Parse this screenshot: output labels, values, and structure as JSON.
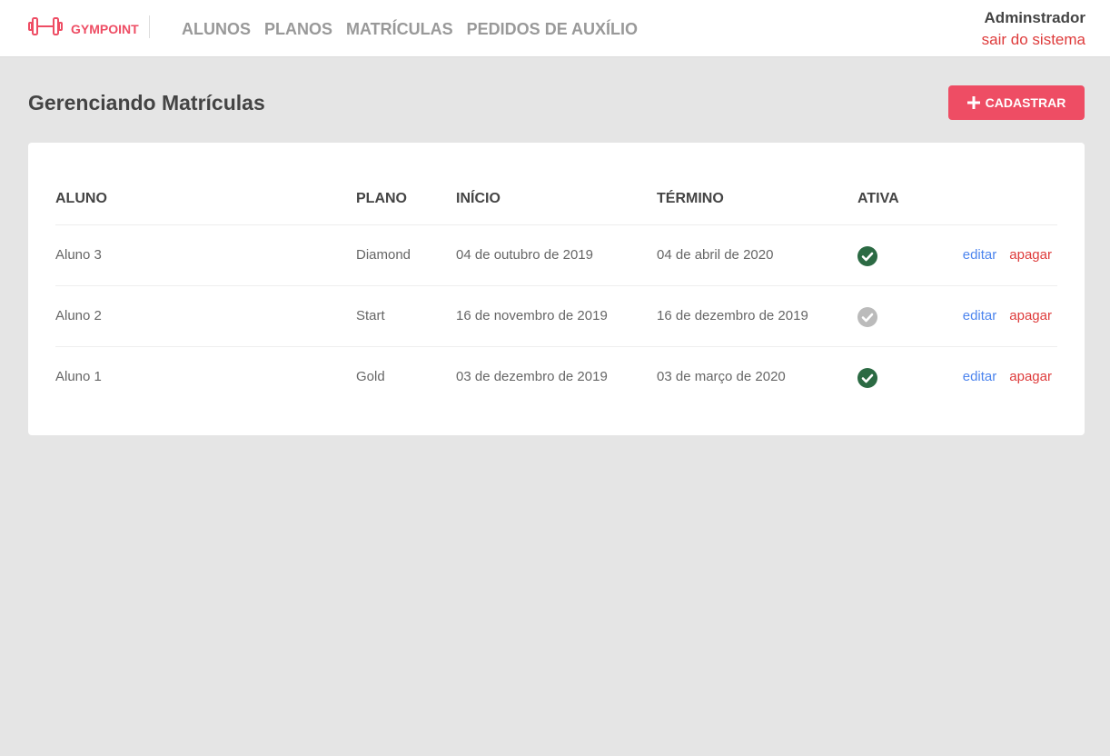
{
  "header": {
    "logo_text": "GYMPOINT",
    "nav": [
      "ALUNOS",
      "PLANOS",
      "MATRÍCULAS",
      "PEDIDOS DE AUXÍLIO"
    ],
    "user_name": "Adminstrador",
    "logout_label": "sair do sistema"
  },
  "page": {
    "title": "Gerenciando Matrículas",
    "add_button_label": "CADASTRAR"
  },
  "table": {
    "columns": [
      "ALUNO",
      "PLANO",
      "INÍCIO",
      "TÉRMINO",
      "ATIVA"
    ],
    "rows": [
      {
        "aluno": "Aluno 3",
        "plano": "Diamond",
        "inicio": "04 de outubro de 2019",
        "termino": "04 de abril de 2020",
        "ativa": true,
        "edit": "editar",
        "delete": "apagar"
      },
      {
        "aluno": "Aluno 2",
        "plano": "Start",
        "inicio": "16 de novembro de 2019",
        "termino": "16 de dezembro de 2019",
        "ativa": false,
        "edit": "editar",
        "delete": "apagar"
      },
      {
        "aluno": "Aluno 1",
        "plano": "Gold",
        "inicio": "03 de dezembro de 2019",
        "termino": "03 de março de 2020",
        "ativa": true,
        "edit": "editar",
        "delete": "apagar"
      }
    ]
  },
  "colors": {
    "brand": "#ee4d64",
    "active_check": "#2b6a43",
    "inactive_check": "#bbbbbb",
    "edit_link": "#4d85ee",
    "delete_link": "#de3b3b"
  },
  "icons": {
    "logo": "dumbbell-icon",
    "add": "plus-icon",
    "active": "check-circle-icon"
  }
}
